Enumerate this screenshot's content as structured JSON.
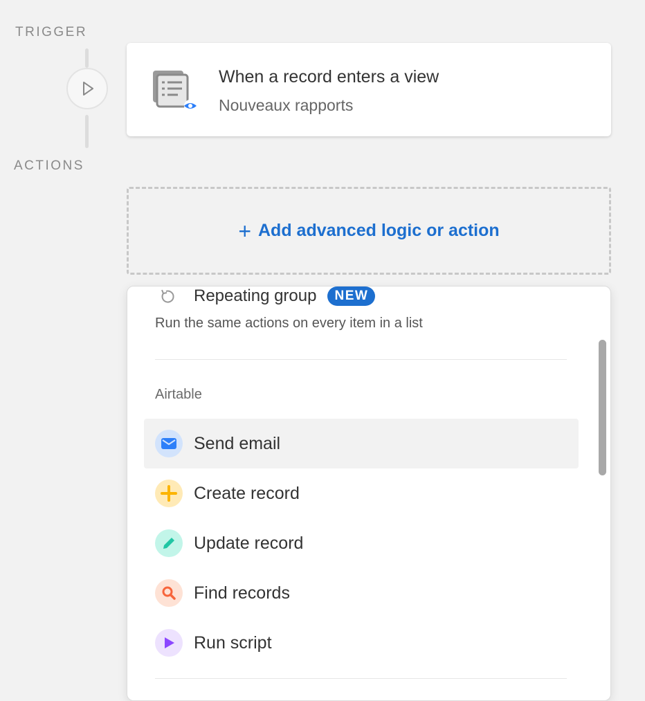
{
  "sections": {
    "trigger_label": "TRIGGER",
    "actions_label": "ACTIONS"
  },
  "trigger": {
    "node_icon": "play-icon",
    "icon": "view-record-icon",
    "title": "When a record enters a view",
    "subtitle": "Nouveaux rapports"
  },
  "add_action": {
    "icon": "plus-icon",
    "label": "Add advanced logic or action"
  },
  "menu": {
    "repeating_group": {
      "icon": "repeat-icon",
      "title": "Repeating group",
      "badge": "NEW",
      "description": "Run the same actions on every item in a list"
    },
    "group_label": "Airtable",
    "items": [
      {
        "label": "Send email",
        "icon": "envelope-icon",
        "color": "#2d7ff9",
        "bg": "#d2e3fc"
      },
      {
        "label": "Create record",
        "icon": "plus-icon",
        "color": "#fcb400",
        "bg": "#ffeab6"
      },
      {
        "label": "Update record",
        "icon": "pencil-icon",
        "color": "#20c6a4",
        "bg": "#c2f5e9"
      },
      {
        "label": "Find records",
        "icon": "search-icon",
        "color": "#f7653b",
        "bg": "#fee2d5"
      },
      {
        "label": "Run script",
        "icon": "play-icon",
        "color": "#8b46ff",
        "bg": "#ede2fe"
      }
    ]
  },
  "colors": {
    "accent": "#1d6fcf",
    "background": "#f2f2f2"
  }
}
